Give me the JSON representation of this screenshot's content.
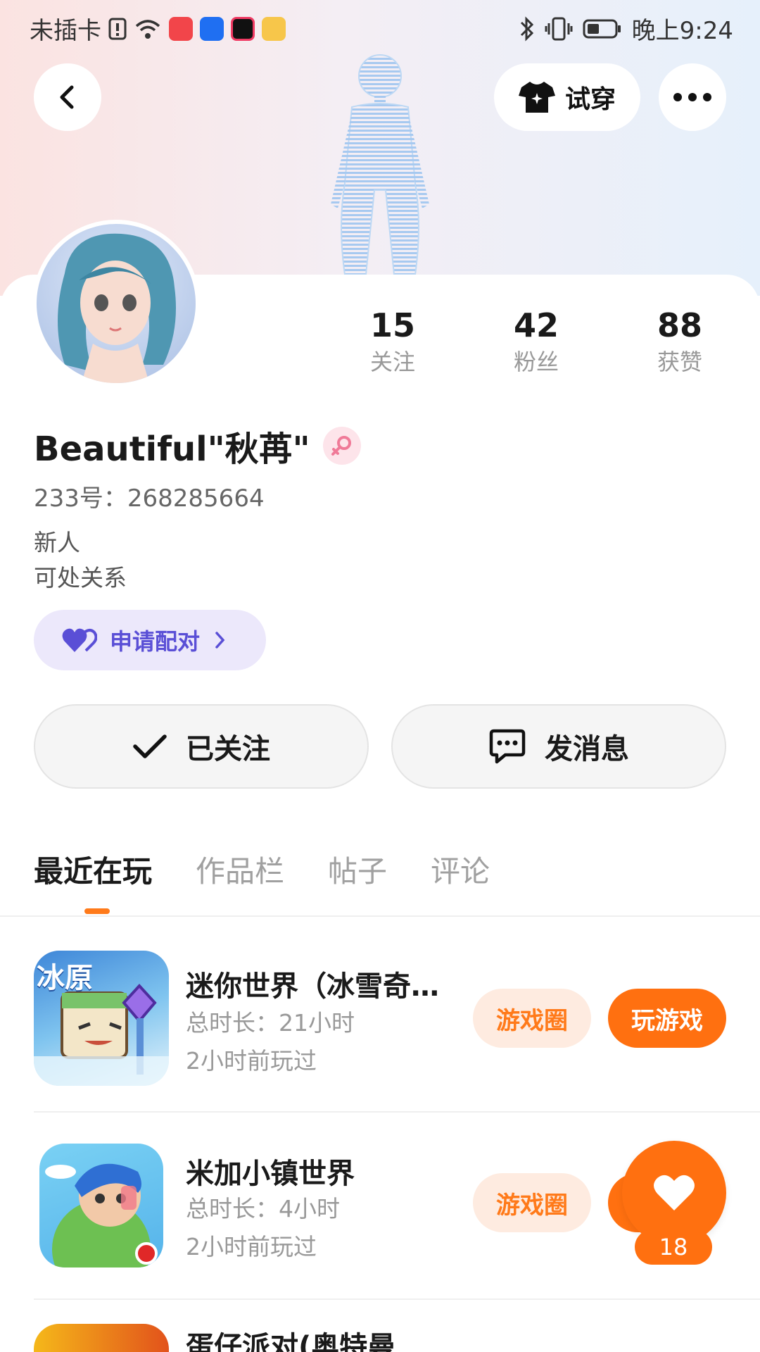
{
  "status_bar": {
    "carrier": "未插卡",
    "time": "晚上9:24"
  },
  "header": {
    "tryon_label": "试穿"
  },
  "profile": {
    "stats": [
      {
        "value": "15",
        "label": "关注"
      },
      {
        "value": "42",
        "label": "粉丝"
      },
      {
        "value": "88",
        "label": "获赞"
      }
    ],
    "name": "Beautiful\"秋苒\"",
    "uid": "233号：268285664",
    "bio_line1": "新人",
    "bio_line2": "可处关系",
    "pair_label": "申请配对",
    "follow_label": "已关注",
    "message_label": "发消息"
  },
  "tabs": [
    {
      "label": "最近在玩",
      "active": true
    },
    {
      "label": "作品栏",
      "active": false
    },
    {
      "label": "帖子",
      "active": false
    },
    {
      "label": "评论",
      "active": false
    }
  ],
  "games": [
    {
      "title": "迷你世界（冰雪奇…",
      "duration": "总时长：21小时",
      "last_played": "2小时前玩过",
      "circle_label": "游戏圈",
      "play_label": "玩游戏",
      "icon_text": "冰原"
    },
    {
      "title": "米加小镇世界",
      "duration": "总时长：4小时",
      "last_played": "2小时前玩过",
      "circle_label": "游戏圈"
    },
    {
      "title": "蛋仔派对(奥特曼"
    }
  ],
  "like_badge": {
    "count": "18"
  },
  "colors": {
    "accent": "#ff7010",
    "pair_purple": "#5a4fd6"
  }
}
